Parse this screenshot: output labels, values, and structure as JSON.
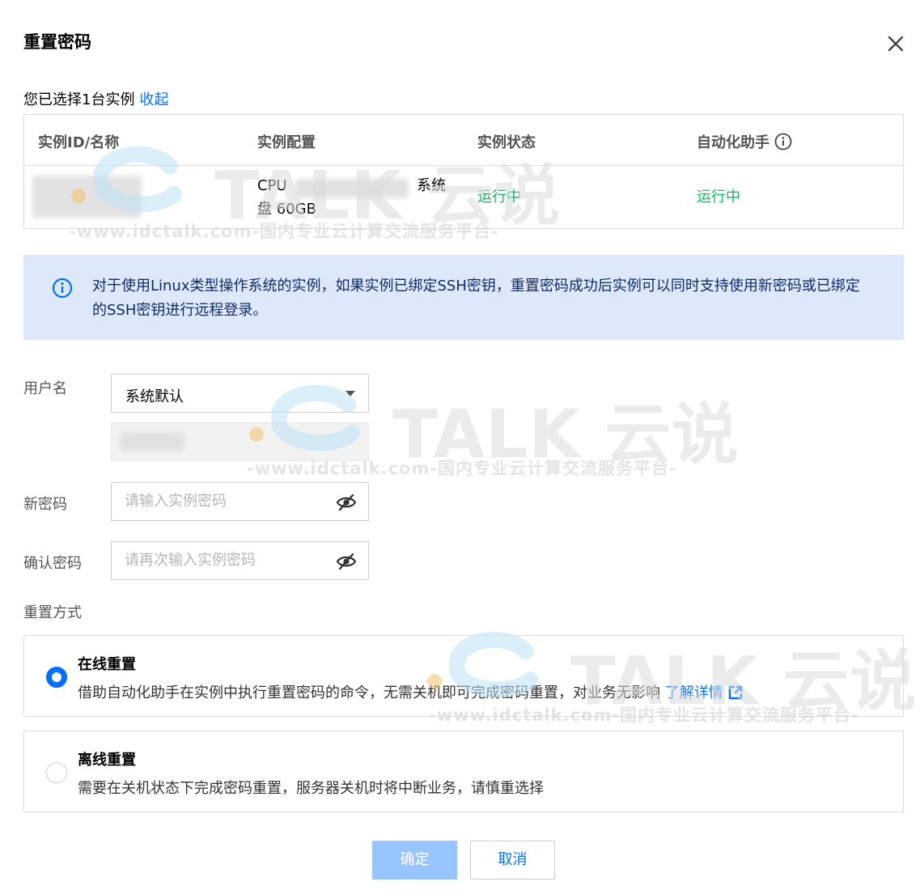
{
  "dialog": {
    "title": "重置密码",
    "close": "×"
  },
  "selection": {
    "summary": "您已选择1台实例",
    "collapse_link": "收起"
  },
  "table": {
    "headers": [
      "实例ID/名称",
      "实例配置",
      "实例状态",
      "自动化助手"
    ],
    "row": {
      "config_line1": "CPU",
      "config_partial": "系统",
      "config_line2": "盘 60GB",
      "status": "运行中",
      "assistant_status": "运行中"
    }
  },
  "notice": {
    "text": "对于使用Linux类型操作系统的实例，如果实例已绑定SSH密钥，重置密码成功后实例可以同时支持使用新密码或已绑定的SSH密钥进行远程登录。"
  },
  "form": {
    "username_label": "用户名",
    "username_value": "系统默认",
    "new_password_label": "新密码",
    "new_password_placeholder": "请输入实例密码",
    "confirm_password_label": "确认密码",
    "confirm_password_placeholder": "请再次输入实例密码",
    "reset_mode_label": "重置方式"
  },
  "options": [
    {
      "title": "在线重置",
      "desc": "借助自动化助手在实例中执行重置密码的命令，无需关机即可完成密码重置，对业务无影响",
      "link": "了解详情",
      "selected": true
    },
    {
      "title": "离线重置",
      "desc": "需要在关机状态下完成密码重置，服务器关机时将中断业务，请慎重选择",
      "selected": false
    }
  ],
  "buttons": {
    "confirm": "确定",
    "cancel": "取消"
  },
  "watermark": {
    "brand": "TALK 云说",
    "url": "-www.idctalk.com-国内专业云计算交流服务平台-"
  },
  "colors": {
    "accent": "#006eff",
    "success": "#0abf5b",
    "notice_bg": "#dde9fb",
    "disabled_button": "#99c5ff"
  }
}
